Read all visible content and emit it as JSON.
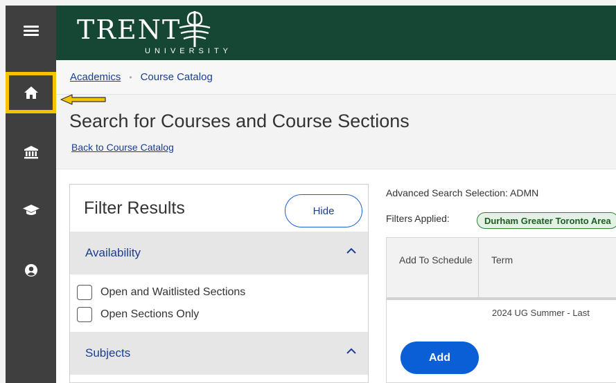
{
  "logo": {
    "wordmark": "TRENT",
    "subtitle": "UNIVERSITY"
  },
  "nav": {
    "icons": [
      "menu-icon",
      "home-icon",
      "institution-icon",
      "graduation-cap-icon",
      "user-icon"
    ],
    "highlight_color": "#f5c400"
  },
  "breadcrumb": {
    "first": "Academics",
    "separator": "•",
    "second": "Course Catalog"
  },
  "page": {
    "title": "Search for Courses and Course Sections",
    "back_link": "Back to Course Catalog"
  },
  "filter": {
    "title": "Filter Results",
    "hide_label": "Hide",
    "sections": [
      {
        "label": "Availability",
        "options": [
          "Open and Waitlisted Sections",
          "Open Sections Only"
        ]
      },
      {
        "label": "Subjects"
      }
    ]
  },
  "results": {
    "advanced_search": "Advanced Search Selection: ADMN",
    "filters_applied_label": "Filters Applied:",
    "filter_tag": "Durham Greater Toronto Area",
    "columns": [
      "Add To Schedule",
      "Term"
    ],
    "rows": [
      {
        "term": "2024 UG Summer - Last",
        "action": "Add"
      }
    ]
  },
  "colors": {
    "header_green": "#154734",
    "sidebar": "#3f3f3f",
    "link_blue": "#1a3d91",
    "button_blue": "#0b5fd6"
  }
}
